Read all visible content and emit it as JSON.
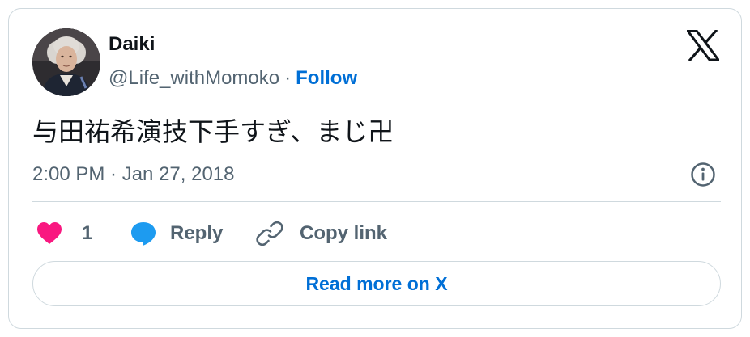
{
  "author": {
    "name": "Daiki",
    "handle": "@Life_withMomoko",
    "separator": "·",
    "follow_label": "Follow"
  },
  "tweet": {
    "text": "与田祐希演技下手すぎ、まじ卍",
    "timestamp": "2:00 PM · Jan 27, 2018"
  },
  "actions": {
    "like_count": "1",
    "reply_label": "Reply",
    "copy_link_label": "Copy link"
  },
  "footer": {
    "read_more_label": "Read more on X"
  },
  "icons": {
    "brand": "x-logo-icon",
    "info": "info-icon",
    "like": "heart-icon",
    "reply": "speech-bubble-icon",
    "copy": "link-icon"
  },
  "colors": {
    "text_primary": "#0f1419",
    "text_secondary": "#536471",
    "link_blue": "#006fd6",
    "heart_pink": "#f91880",
    "reply_blue": "#1d9bf0",
    "border": "#cfd9de"
  }
}
